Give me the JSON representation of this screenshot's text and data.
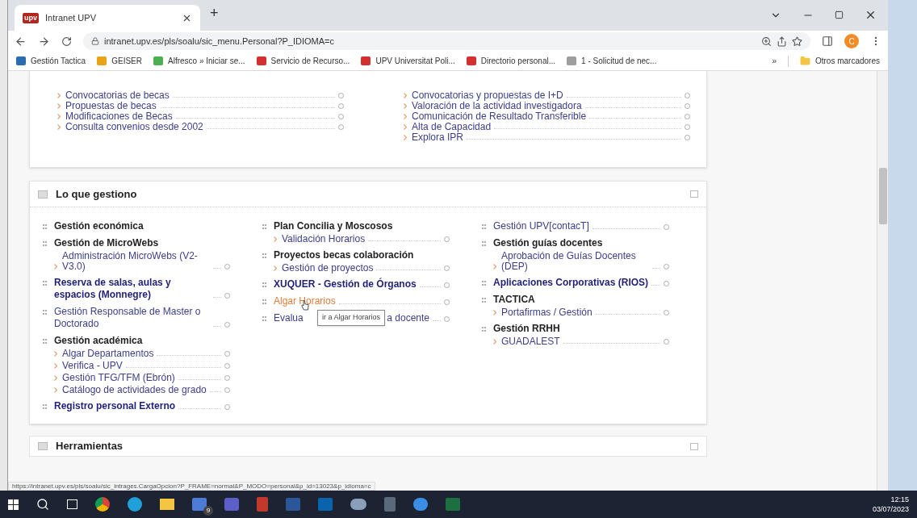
{
  "browser": {
    "tabs": [
      {
        "title": "Intranet UPV",
        "favicon": "upv",
        "selected": true
      }
    ],
    "new_tab": "+",
    "url": "intranet.upv.es/pls/soalu/sic_menu.Personal?P_IDIOMA=c",
    "profile": "C",
    "bookmarks": [
      {
        "label": "Gestión Tactica",
        "color": "#2b6cb0"
      },
      {
        "label": "GEISER",
        "color": "#e8a317"
      },
      {
        "label": "Alfresco » Iniciar se...",
        "color": "#4caf50"
      },
      {
        "label": "Servicio de Recurso...",
        "color": "#d32f2f"
      },
      {
        "label": "UPV Universitat Poli...",
        "color": "#d32f2f"
      },
      {
        "label": "Directorio personal...",
        "color": "#d32f2f"
      },
      {
        "label": "1 - Solicitud de nec...",
        "color": "#9e9e9e"
      }
    ],
    "more_bookmarks": "»",
    "other_bookmarks": "Otros marcadores"
  },
  "top_card": {
    "columns": [
      [
        "Convocatorias de becas",
        "Propuestas de becas",
        "Modificaciones de Becas",
        "Consulta convenios desde 2002"
      ],
      [
        "Convocatorias y propuestas de I+D",
        "Valoración de la actividad investigadora",
        "Comunicación de Resultado Transferible",
        "Alta de Capacidad",
        "Explora IPR"
      ]
    ]
  },
  "section": {
    "title": "Lo que gestiono",
    "columns": [
      [
        {
          "kind": "heading",
          "label": "Gestión económica"
        },
        {
          "kind": "heading",
          "label": "Gestión de MicroWebs",
          "children": [
            "Administración MicroWebs (V2-V3.0)"
          ]
        },
        {
          "kind": "link-heading",
          "label": "Reserva de salas, aulas y espacios (Monnegre)"
        },
        {
          "kind": "link",
          "label": "Gestión Responsable de Master o Doctorado"
        },
        {
          "kind": "heading",
          "label": "Gestión académica",
          "children": [
            "Algar Departamentos",
            "Verifica - UPV",
            "Gestión TFG/TFM (Ebrón)",
            "Catálogo de actividades de grado"
          ]
        },
        {
          "kind": "link-heading",
          "label": "Registro personal Externo"
        }
      ],
      [
        {
          "kind": "heading",
          "label": "Plan Concilia y Moscosos",
          "children": [
            "Validación Horarios"
          ]
        },
        {
          "kind": "heading",
          "label": "Proyectos becas colaboración",
          "children": [
            "Gestión de proyectos"
          ]
        },
        {
          "kind": "link-heading",
          "label": "XUQUER - Gestión de Órganos"
        },
        {
          "kind": "hovered-link",
          "label": "Algar Horarios",
          "tooltip": "ir a Algar Horarios"
        },
        {
          "kind": "link",
          "label": "Evalua",
          "label_tail": "a docente"
        }
      ],
      [
        {
          "kind": "link",
          "label": "Gestión UPV[contacT]"
        },
        {
          "kind": "heading",
          "label": "Gestión guías docentes",
          "children": [
            "Aprobación de Guías Docentes (DEP)"
          ]
        },
        {
          "kind": "link-heading",
          "label": "Aplicaciones Corporativas (RIOS)"
        },
        {
          "kind": "heading",
          "label": "TACTICA",
          "children": [
            "Portafirmas / Gestión"
          ]
        },
        {
          "kind": "heading",
          "label": "Gestión RRHH",
          "children": [
            "GUADALEST"
          ]
        }
      ]
    ]
  },
  "next_section": {
    "title": "Herramientas"
  },
  "status_url": "https://intranet.upv.es/pls/soalu/sic_intrages.CargaOpcion?P_FRAME=normal&P_MODO=personal&p_id=13023&p_idioma=c",
  "taskbar": {
    "badge": "9",
    "time": "12:15",
    "date": "03/07/2023"
  }
}
